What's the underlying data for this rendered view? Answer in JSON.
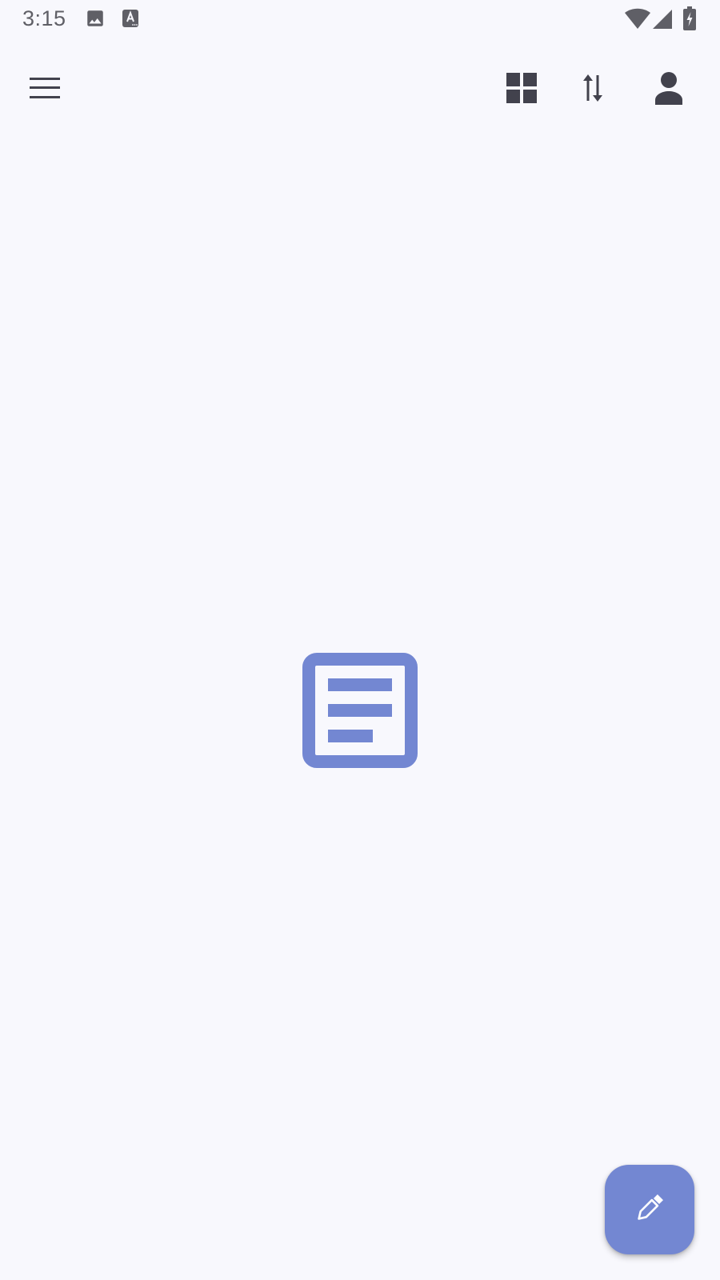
{
  "status_bar": {
    "time": "3:15",
    "left_icons": [
      "image-icon",
      "text-notification-icon"
    ],
    "right_icons": [
      "wifi-icon",
      "signal-icon",
      "battery-charging-icon"
    ]
  },
  "app_bar": {
    "left_icon": "menu-icon",
    "right_icons": [
      "grid-view-icon",
      "sort-icon",
      "account-icon"
    ]
  },
  "empty_state": {
    "icon": "notes-icon"
  },
  "fab": {
    "icon": "pencil-icon"
  },
  "colors": {
    "background": "#f8f8fd",
    "accent": "#7387d2",
    "icon_dark": "#42424d",
    "status_grey": "#5f5f66"
  }
}
